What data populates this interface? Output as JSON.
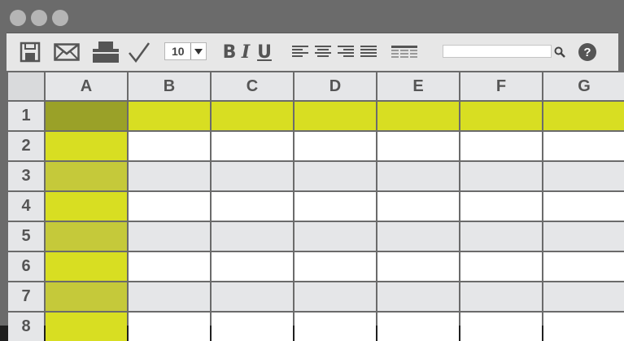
{
  "window": {
    "title_dots": [
      "close",
      "minimize",
      "maximize"
    ]
  },
  "toolbar": {
    "icons": [
      "save-icon",
      "mail-icon",
      "print-icon",
      "check-icon"
    ],
    "font_size": "10",
    "bold_label": "B",
    "italic_label": "I",
    "underline_label": "U",
    "align_icons": [
      "align-left-icon",
      "align-center-icon",
      "align-right-icon",
      "align-justify-icon"
    ],
    "table_icon": "table-icon",
    "search_value": "",
    "search_icon": "search-icon",
    "help_label": "?"
  },
  "sheet": {
    "columns": [
      "A",
      "B",
      "C",
      "D",
      "E",
      "F",
      "G"
    ],
    "rows": [
      "1",
      "2",
      "3",
      "4",
      "5",
      "6",
      "7",
      "8"
    ],
    "colors": {
      "header_bg": "#e5e6e8",
      "highlight": "#d8de22",
      "highlight_dark": "#9aa128",
      "highlight_mid": "#c5c93a",
      "white": "#ffffff",
      "light_gray": "#e5e6e8",
      "grid_line": "#6b6b6b"
    }
  }
}
